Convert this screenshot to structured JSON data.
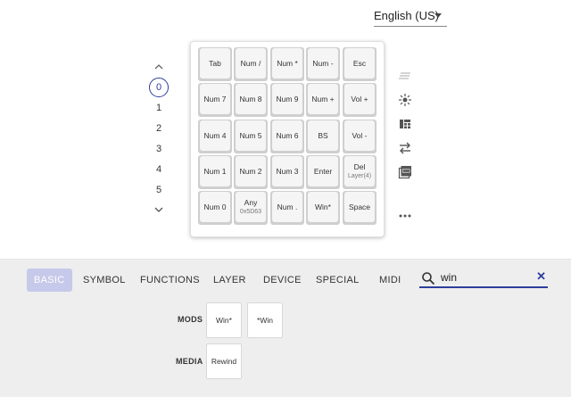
{
  "language": {
    "selected": "English (US)"
  },
  "layers": {
    "items": [
      "0",
      "1",
      "2",
      "3",
      "4",
      "5"
    ],
    "selected": "0"
  },
  "keymap": {
    "rows": [
      [
        {
          "label": "Tab"
        },
        {
          "label": "Num /"
        },
        {
          "label": "Num *"
        },
        {
          "label": "Num -"
        },
        {
          "label": "Esc"
        }
      ],
      [
        {
          "label": "Num 7"
        },
        {
          "label": "Num 8"
        },
        {
          "label": "Num 9"
        },
        {
          "label": "Num +"
        },
        {
          "label": "Vol +"
        }
      ],
      [
        {
          "label": "Num 4"
        },
        {
          "label": "Num 5"
        },
        {
          "label": "Num 6"
        },
        {
          "label": "BS"
        },
        {
          "label": "Vol -"
        }
      ],
      [
        {
          "label": "Num 1"
        },
        {
          "label": "Num 2"
        },
        {
          "label": "Num 3"
        },
        {
          "label": "Enter"
        },
        {
          "label": "Del",
          "sub": "Layer(4)"
        }
      ],
      [
        {
          "label": "Num 0"
        },
        {
          "label": "Any",
          "sub": "0x5D63"
        },
        {
          "label": "Num ."
        },
        {
          "label": "Win*"
        },
        {
          "label": "Space"
        }
      ]
    ]
  },
  "toolbar": {
    "icons": [
      "notes-icon",
      "light-icon",
      "layout-icon",
      "swap-icon",
      "pdf-icon",
      "more-icon"
    ]
  },
  "tabs": [
    {
      "label": "BASIC",
      "active": true
    },
    {
      "label": "SYMBOL",
      "active": false
    },
    {
      "label": "FUNCTIONS",
      "active": false
    },
    {
      "label": "LAYER",
      "active": false
    },
    {
      "label": "DEVICE",
      "active": false
    },
    {
      "label": "SPECIAL",
      "active": false
    },
    {
      "label": "MIDI",
      "active": false
    }
  ],
  "search": {
    "value": "win",
    "clear_label": "✕"
  },
  "results": [
    {
      "category": "MODS",
      "keys": [
        "Win*",
        "*Win"
      ]
    },
    {
      "category": "MEDIA",
      "keys": [
        "Rewind"
      ]
    }
  ],
  "colors": {
    "accent": "#2c3e9a",
    "active_tab": "#c7c9ea",
    "panel_bg": "#eeeeee"
  }
}
